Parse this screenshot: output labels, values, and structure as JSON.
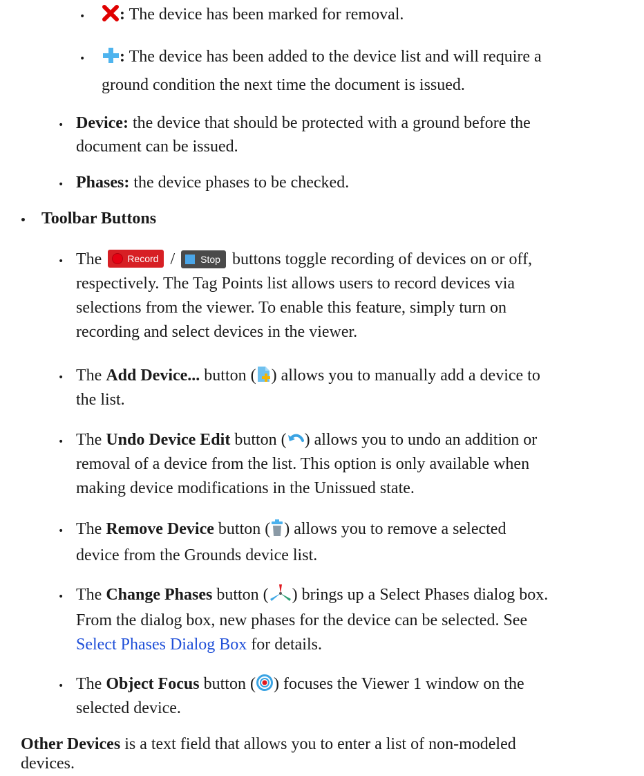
{
  "status_items": [
    {
      "icon": "red-x-icon",
      "label": ":",
      "text": " The device has been marked for removal."
    },
    {
      "icon": "blue-plus-icon",
      "label": ":",
      "text_line1": " The device has been added to the device list and will require a",
      "text_line2": "ground condition the next time the document is issued."
    }
  ],
  "columns": [
    {
      "term": "Device:",
      "line1": " the device that should be protected with a ground before the",
      "line2": "document can be issued."
    },
    {
      "term": "Phases:",
      "line1": " the device phases to be checked."
    }
  ],
  "toolbar_heading": "Toolbar Buttons",
  "record_stop": {
    "prefix": "The ",
    "record_label": "Record",
    "slash": "/",
    "stop_label": "Stop",
    "suffix": " buttons toggle recording of devices on or off,",
    "line2": "respectively. The Tag Points list allows users to record devices via",
    "line3": "selections from the viewer. To enable this feature, simply turn on",
    "line4": "recording and select devices in the viewer."
  },
  "add_device": {
    "prefix": "The ",
    "name": "Add Device...",
    "mid": " button (",
    "suffix": ") allows you to manually add a device to",
    "line2": "the list."
  },
  "undo_device": {
    "prefix": "The ",
    "name": "Undo Device Edit",
    "mid": " button (",
    "suffix": ") allows you to undo an addition or",
    "line2": "removal of a device from the list. This option is only available when",
    "line3": "making device modifications in the Unissued state."
  },
  "remove_device": {
    "prefix": "The ",
    "name": "Remove Device",
    "mid": " button (",
    "suffix": ") allows you to remove a selected",
    "line2": "device from the Grounds device list."
  },
  "change_phases": {
    "prefix": "The ",
    "name": "Change Phases",
    "mid": " button (",
    "suffix": ") brings up a Select Phases dialog box.",
    "line2": "From the dialog box, new phases for the device can be selected. See",
    "link": "Select Phases Dialog Box",
    "line3_suffix": " for details."
  },
  "object_focus": {
    "prefix": "The ",
    "name": "Object Focus",
    "mid": " button (",
    "suffix": ") focuses the Viewer 1 window on the",
    "line2": "selected device."
  },
  "other_devices": {
    "name": "Other Devices",
    "line1": " is a text field that allows you to enter a list of non-modeled",
    "line2": "devices."
  },
  "bullet_glyph": "•"
}
